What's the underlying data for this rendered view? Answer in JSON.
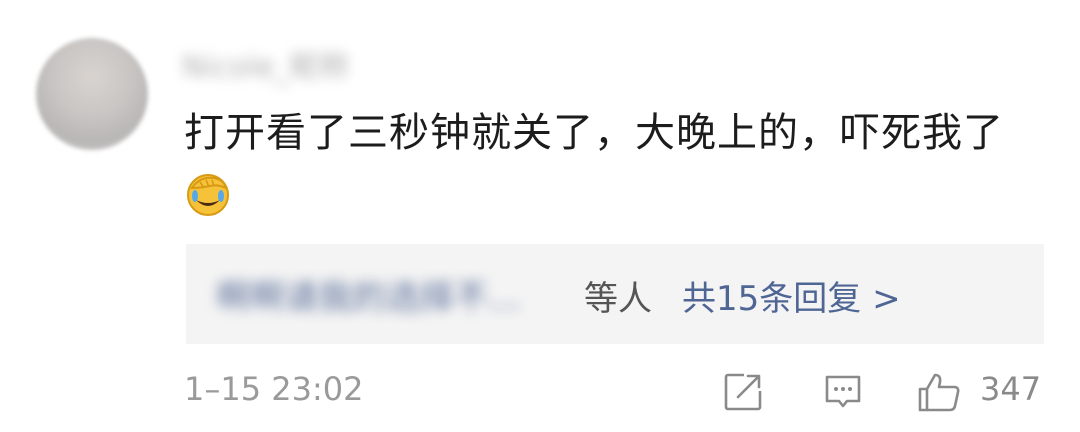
{
  "comment": {
    "username": "Nicole_昵称",
    "text": "打开看了三秒钟就关了，大晚上的，吓死我了",
    "emoji": "facepalm-laughing-emoji"
  },
  "replies": {
    "names": "啊啊请我的选择不...",
    "suffix": "等人",
    "count_label": "共15条回复 >"
  },
  "meta": {
    "timestamp": "1–15 23:02",
    "like_count": "347"
  },
  "icons": {
    "forward": "share-square-icon",
    "reply": "comment-bubble-icon",
    "like": "thumbs-up-icon"
  }
}
